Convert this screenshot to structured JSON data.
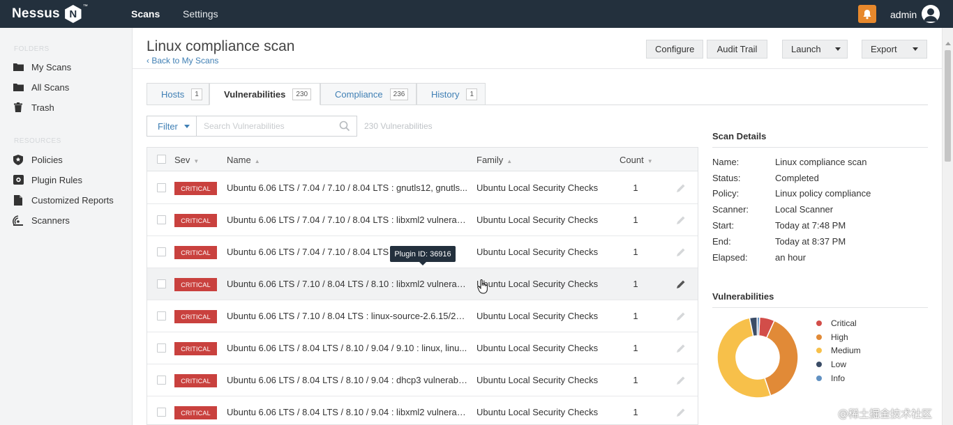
{
  "app": {
    "logo_text": "Nessus",
    "logo_badge": "N",
    "logo_tm": "™"
  },
  "topnav": {
    "scans": "Scans",
    "settings": "Settings",
    "user": "admin"
  },
  "sidebar": {
    "folders_heading": "FOLDERS",
    "folders": [
      {
        "label": "My Scans",
        "icon": "folder-icon"
      },
      {
        "label": "All Scans",
        "icon": "folder-icon"
      },
      {
        "label": "Trash",
        "icon": "trash-icon"
      }
    ],
    "resources_heading": "RESOURCES",
    "resources": [
      {
        "label": "Policies",
        "icon": "policy-icon"
      },
      {
        "label": "Plugin Rules",
        "icon": "plugin-rules-icon"
      },
      {
        "label": "Customized Reports",
        "icon": "report-icon"
      },
      {
        "label": "Scanners",
        "icon": "scanner-icon"
      }
    ]
  },
  "header": {
    "title": "Linux compliance scan",
    "back_link": "‹ Back to My Scans",
    "buttons": {
      "configure": "Configure",
      "audit_trail": "Audit Trail",
      "launch": "Launch",
      "export": "Export"
    }
  },
  "tabs": [
    {
      "label": "Hosts",
      "count": "1"
    },
    {
      "label": "Vulnerabilities",
      "count": "230"
    },
    {
      "label": "Compliance",
      "count": "236"
    },
    {
      "label": "History",
      "count": "1"
    }
  ],
  "filter": {
    "label": "Filter",
    "search_placeholder": "Search Vulnerabilities",
    "result_count": "230 Vulnerabilities"
  },
  "table": {
    "columns": {
      "sev": "Sev",
      "name": "Name",
      "family": "Family",
      "count": "Count"
    },
    "sort_glyphs": {
      "desc": "▼",
      "asc": "▲"
    },
    "rows": [
      {
        "sev": "CRITICAL",
        "name": "Ubuntu 6.06 LTS / 7.04 / 7.10 / 8.04 LTS : gnutls12, gnutls...",
        "family": "Ubuntu Local Security Checks",
        "count": "1"
      },
      {
        "sev": "CRITICAL",
        "name": "Ubuntu 6.06 LTS / 7.04 / 7.10 / 8.04 LTS : libxml2 vulnerab...",
        "family": "Ubuntu Local Security Checks",
        "count": "1"
      },
      {
        "sev": "CRITICAL",
        "name": "Ubuntu 6.06 LTS / 7.04 / 7.10 / 8.04 LTS : ...",
        "family": "Ubuntu Local Security Checks",
        "count": "1"
      },
      {
        "sev": "CRITICAL",
        "name": "Ubuntu 6.06 LTS / 7.10 / 8.04 LTS / 8.10 : libxml2 vulnerab...",
        "family": "Ubuntu Local Security Checks",
        "count": "1"
      },
      {
        "sev": "CRITICAL",
        "name": "Ubuntu 6.06 LTS / 7.10 / 8.04 LTS : linux-source-2.6.15/22,...",
        "family": "Ubuntu Local Security Checks",
        "count": "1"
      },
      {
        "sev": "CRITICAL",
        "name": "Ubuntu 6.06 LTS / 8.04 LTS / 8.10 / 9.04 / 9.10 : linux, linu...",
        "family": "Ubuntu Local Security Checks",
        "count": "1"
      },
      {
        "sev": "CRITICAL",
        "name": "Ubuntu 6.06 LTS / 8.04 LTS / 8.10 / 9.04 : dhcp3 vulnerabi...",
        "family": "Ubuntu Local Security Checks",
        "count": "1"
      },
      {
        "sev": "CRITICAL",
        "name": "Ubuntu 6.06 LTS / 8.04 LTS / 8.10 / 9.04 : libxml2 vulnerab...",
        "family": "Ubuntu Local Security Checks",
        "count": "1"
      }
    ],
    "tooltip": "Plugin ID: 36916"
  },
  "scan_details": {
    "title": "Scan Details",
    "fields": [
      {
        "label": "Name:",
        "value": "Linux compliance scan"
      },
      {
        "label": "Status:",
        "value": "Completed"
      },
      {
        "label": "Policy:",
        "value": "Linux policy compliance"
      },
      {
        "label": "Scanner:",
        "value": "Local Scanner"
      },
      {
        "label": "Start:",
        "value": "Today at 7:48 PM"
      },
      {
        "label": "End:",
        "value": "Today at 8:37 PM"
      },
      {
        "label": "Elapsed:",
        "value": "an hour"
      }
    ]
  },
  "vulnerabilities_chart": {
    "title": "Vulnerabilities",
    "segments": [
      {
        "label": "Critical",
        "color": "#d24d49",
        "share": 0.06
      },
      {
        "label": "High",
        "color": "#e18a37",
        "share": 0.38
      },
      {
        "label": "Medium",
        "color": "#f7c04a",
        "share": 0.52
      },
      {
        "label": "Low",
        "color": "#3a4c66",
        "share": 0.03
      },
      {
        "label": "Info",
        "color": "#6191c2",
        "share": 0.01
      }
    ]
  },
  "watermark": "@稀土掘金技术社区",
  "colors": {
    "nav_bg": "#23303d",
    "critical": "#c9413e",
    "link": "#3f7fb4",
    "bell": "#e7882c"
  }
}
